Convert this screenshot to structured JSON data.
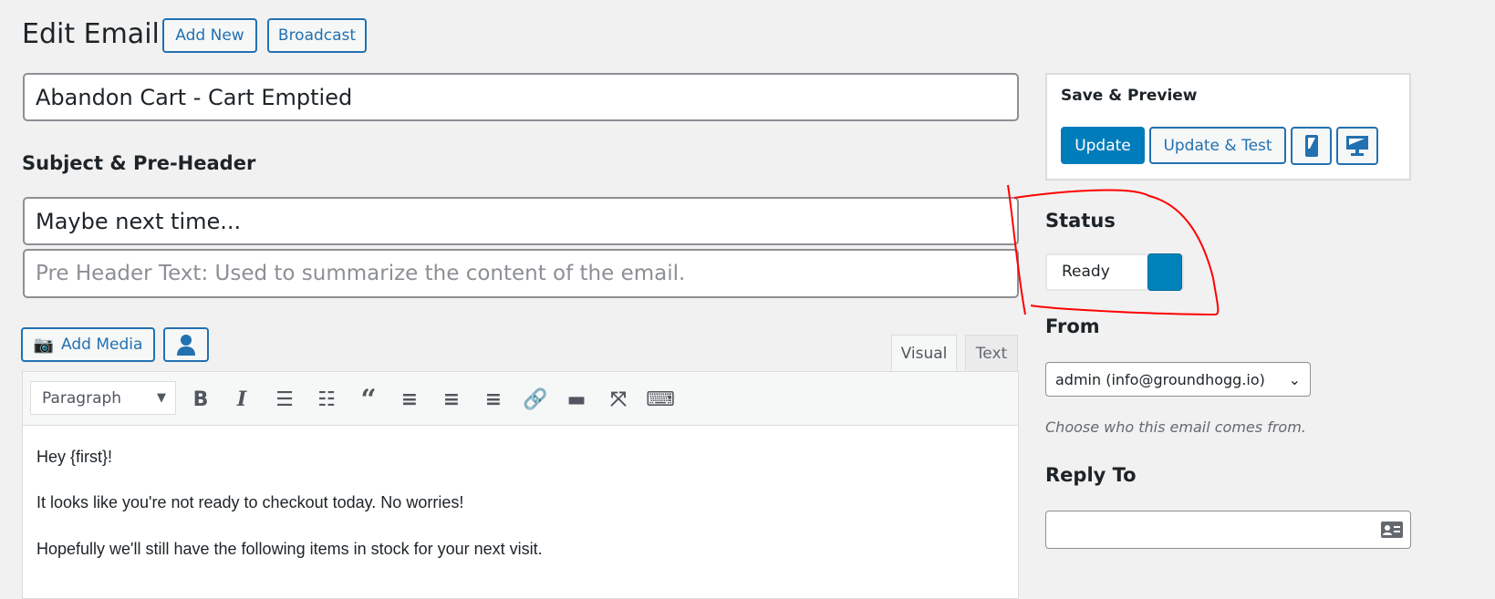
{
  "header": {
    "title": "Edit Email",
    "add_new": "Add New",
    "broadcast": "Broadcast"
  },
  "email": {
    "title": "Abandon Cart - Cart Emptied",
    "subject_heading": "Subject & Pre-Header",
    "subject": "Maybe next time...",
    "preheader_placeholder": "Pre Header Text: Used to summarize the content of the email."
  },
  "editor": {
    "add_media": "Add Media",
    "tabs": [
      "Visual",
      "Text"
    ],
    "format": "Paragraph",
    "content": [
      "Hey {first}!",
      "It looks like you're not ready to checkout today. No worries!",
      "Hopefully we'll still have the following items in stock for your next visit."
    ]
  },
  "sidebar": {
    "save_title": "Save & Preview",
    "update": "Update",
    "update_test": "Update & Test",
    "status_label": "Status",
    "status_value": "Ready",
    "from_label": "From",
    "from_value": "admin (info@groundhogg.io)",
    "from_help": "Choose who this email comes from.",
    "reply_label": "Reply To",
    "reply_value": ""
  },
  "colors": {
    "accent": "#007cba",
    "annotation": "#ff0000"
  }
}
